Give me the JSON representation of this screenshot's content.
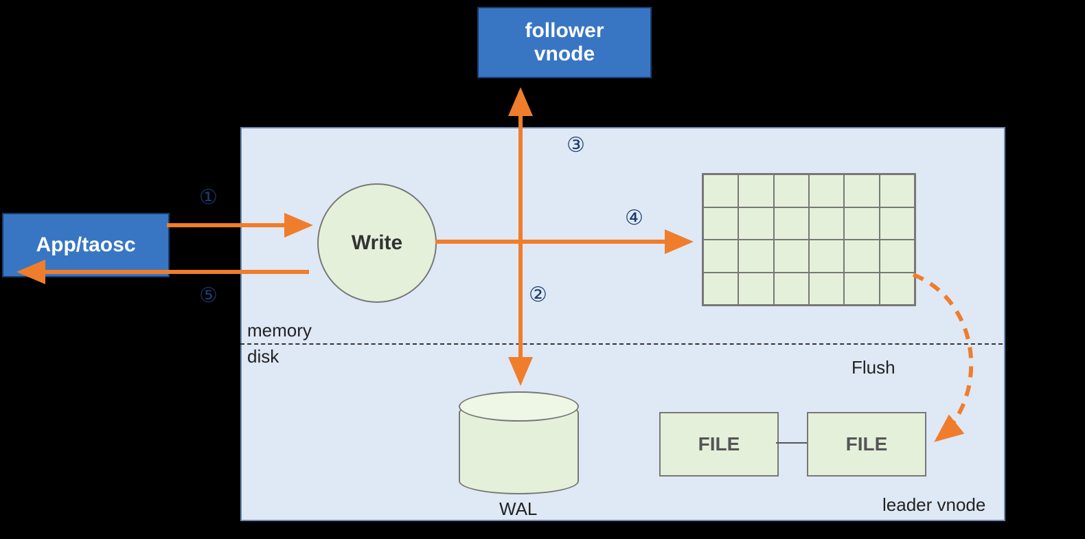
{
  "nodes": {
    "app": "App/taosc",
    "follower_line1": "follower",
    "follower_line2": "vnode",
    "write": "Write",
    "file1": "FILE",
    "file2": "FILE"
  },
  "labels": {
    "memory": "memory",
    "disk": "disk",
    "wal": "WAL",
    "flush": "Flush",
    "leader": "leader vnode"
  },
  "steps": {
    "s1": "①",
    "s2": "②",
    "s3": "③",
    "s4": "④",
    "s5": "⑤"
  },
  "grid": {
    "rows": 4,
    "cols": 6
  },
  "colors": {
    "blue_fill": "#3876c4",
    "panel_fill": "#dfe8f5",
    "green_fill": "#e5f0da",
    "arrow_orange": "#f07d2b",
    "step_color": "#1a3a6b"
  }
}
